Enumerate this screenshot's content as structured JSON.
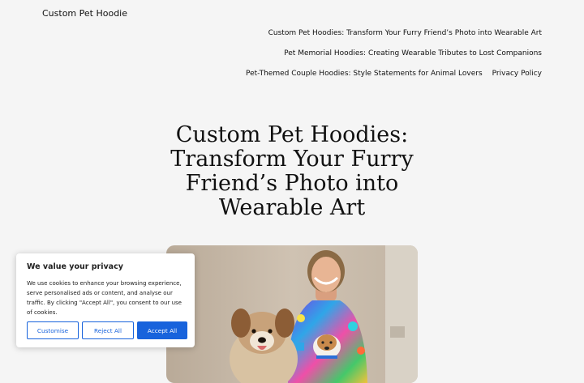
{
  "header": {
    "site_title": "Custom Pet Hoodie",
    "nav": [
      {
        "label": "Custom Pet Hoodies: Transform Your Furry Friend’s Photo into Wearable Art"
      },
      {
        "label": "Pet Memorial Hoodies: Creating Wearable Tributes to Lost Companions"
      },
      {
        "label": "Pet-Themed Couple Hoodies: Style Statements for Animal Lovers"
      },
      {
        "label": "Privacy Policy"
      }
    ]
  },
  "post": {
    "title_lines": [
      "Custom Pet Hoodies:",
      "Transform Your Furry",
      "Friend’s Photo into",
      "Wearable Art"
    ]
  },
  "cookie_banner": {
    "title": "We value your privacy",
    "text": "We use cookies to enhance your browsing experience, serve personalised ads or content, and analyse our traffic. By clicking \"Accept All\", you consent to our use of cookies.",
    "customise_label": "Customise",
    "reject_label": "Reject All",
    "accept_label": "Accept All"
  },
  "colors": {
    "background": "#f5f5f5",
    "cookie_accent": "#1863dc"
  }
}
